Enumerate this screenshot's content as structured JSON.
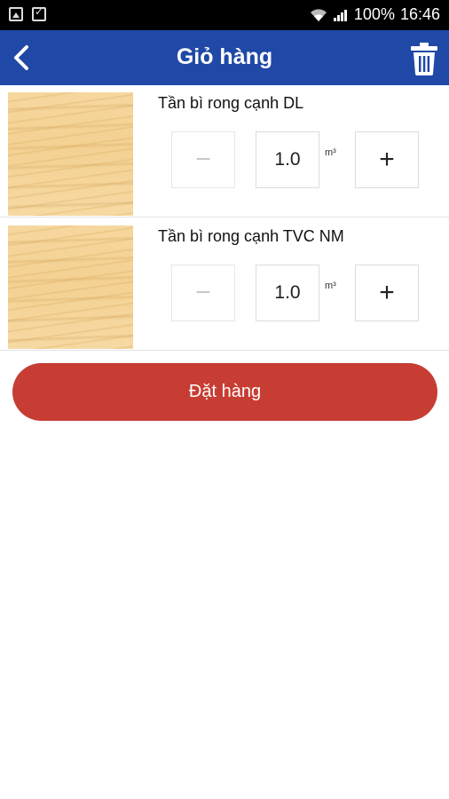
{
  "status_bar": {
    "battery": "100%",
    "time": "16:46"
  },
  "app_bar": {
    "title": "Giỏ hàng"
  },
  "cart": {
    "items": [
      {
        "name": "Tần bì rong cạnh DL",
        "quantity": "1.0",
        "unit": "m³",
        "minus": "−",
        "plus": "+"
      },
      {
        "name": "Tần bì rong cạnh TVC NM",
        "quantity": "1.0",
        "unit": "m³",
        "minus": "−",
        "plus": "+"
      }
    ]
  },
  "order_button": {
    "label": "Đặt hàng"
  },
  "colors": {
    "app_bar": "#1f48a7",
    "order_button": "#c73d33"
  },
  "icons": [
    "gallery-icon",
    "checklist-icon",
    "wifi-icon",
    "signal-icon",
    "back-arrow-icon",
    "trash-icon",
    "wood-texture-image"
  ]
}
